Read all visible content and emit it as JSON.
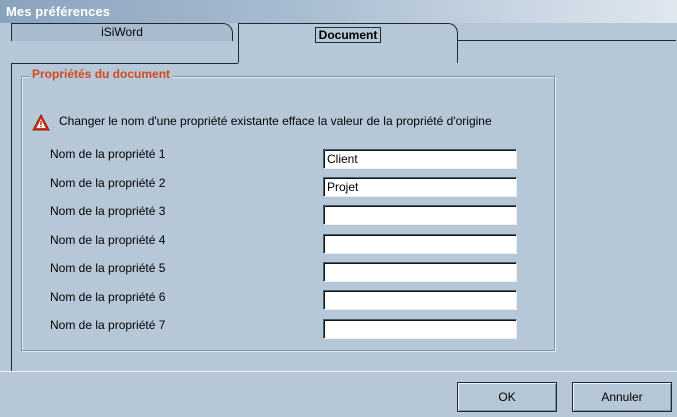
{
  "window": {
    "title": "Mes préférences"
  },
  "tabs": [
    {
      "label": "iSiWord",
      "selected": false
    },
    {
      "label": "Document",
      "selected": true
    }
  ],
  "group": {
    "title": "Propriétés du document",
    "warning": "Changer le nom d'une propriété existante efface la valeur de la propriété d'origine",
    "warning_icon": "warning-triangle-icon"
  },
  "properties": [
    {
      "label": "Nom de la propriété 1",
      "value": "Client"
    },
    {
      "label": "Nom de la propriété 2",
      "value": "Projet"
    },
    {
      "label": "Nom de la propriété 3",
      "value": ""
    },
    {
      "label": "Nom de la propriété 4",
      "value": ""
    },
    {
      "label": "Nom de la propriété 5",
      "value": ""
    },
    {
      "label": "Nom de la propriété 6",
      "value": ""
    },
    {
      "label": "Nom de la propriété 7",
      "value": ""
    }
  ],
  "buttons": {
    "ok": "OK",
    "cancel": "Annuler"
  },
  "colors": {
    "background": "#b6c7d7",
    "group_title": "#d2491f",
    "warning": "#d7321c"
  }
}
